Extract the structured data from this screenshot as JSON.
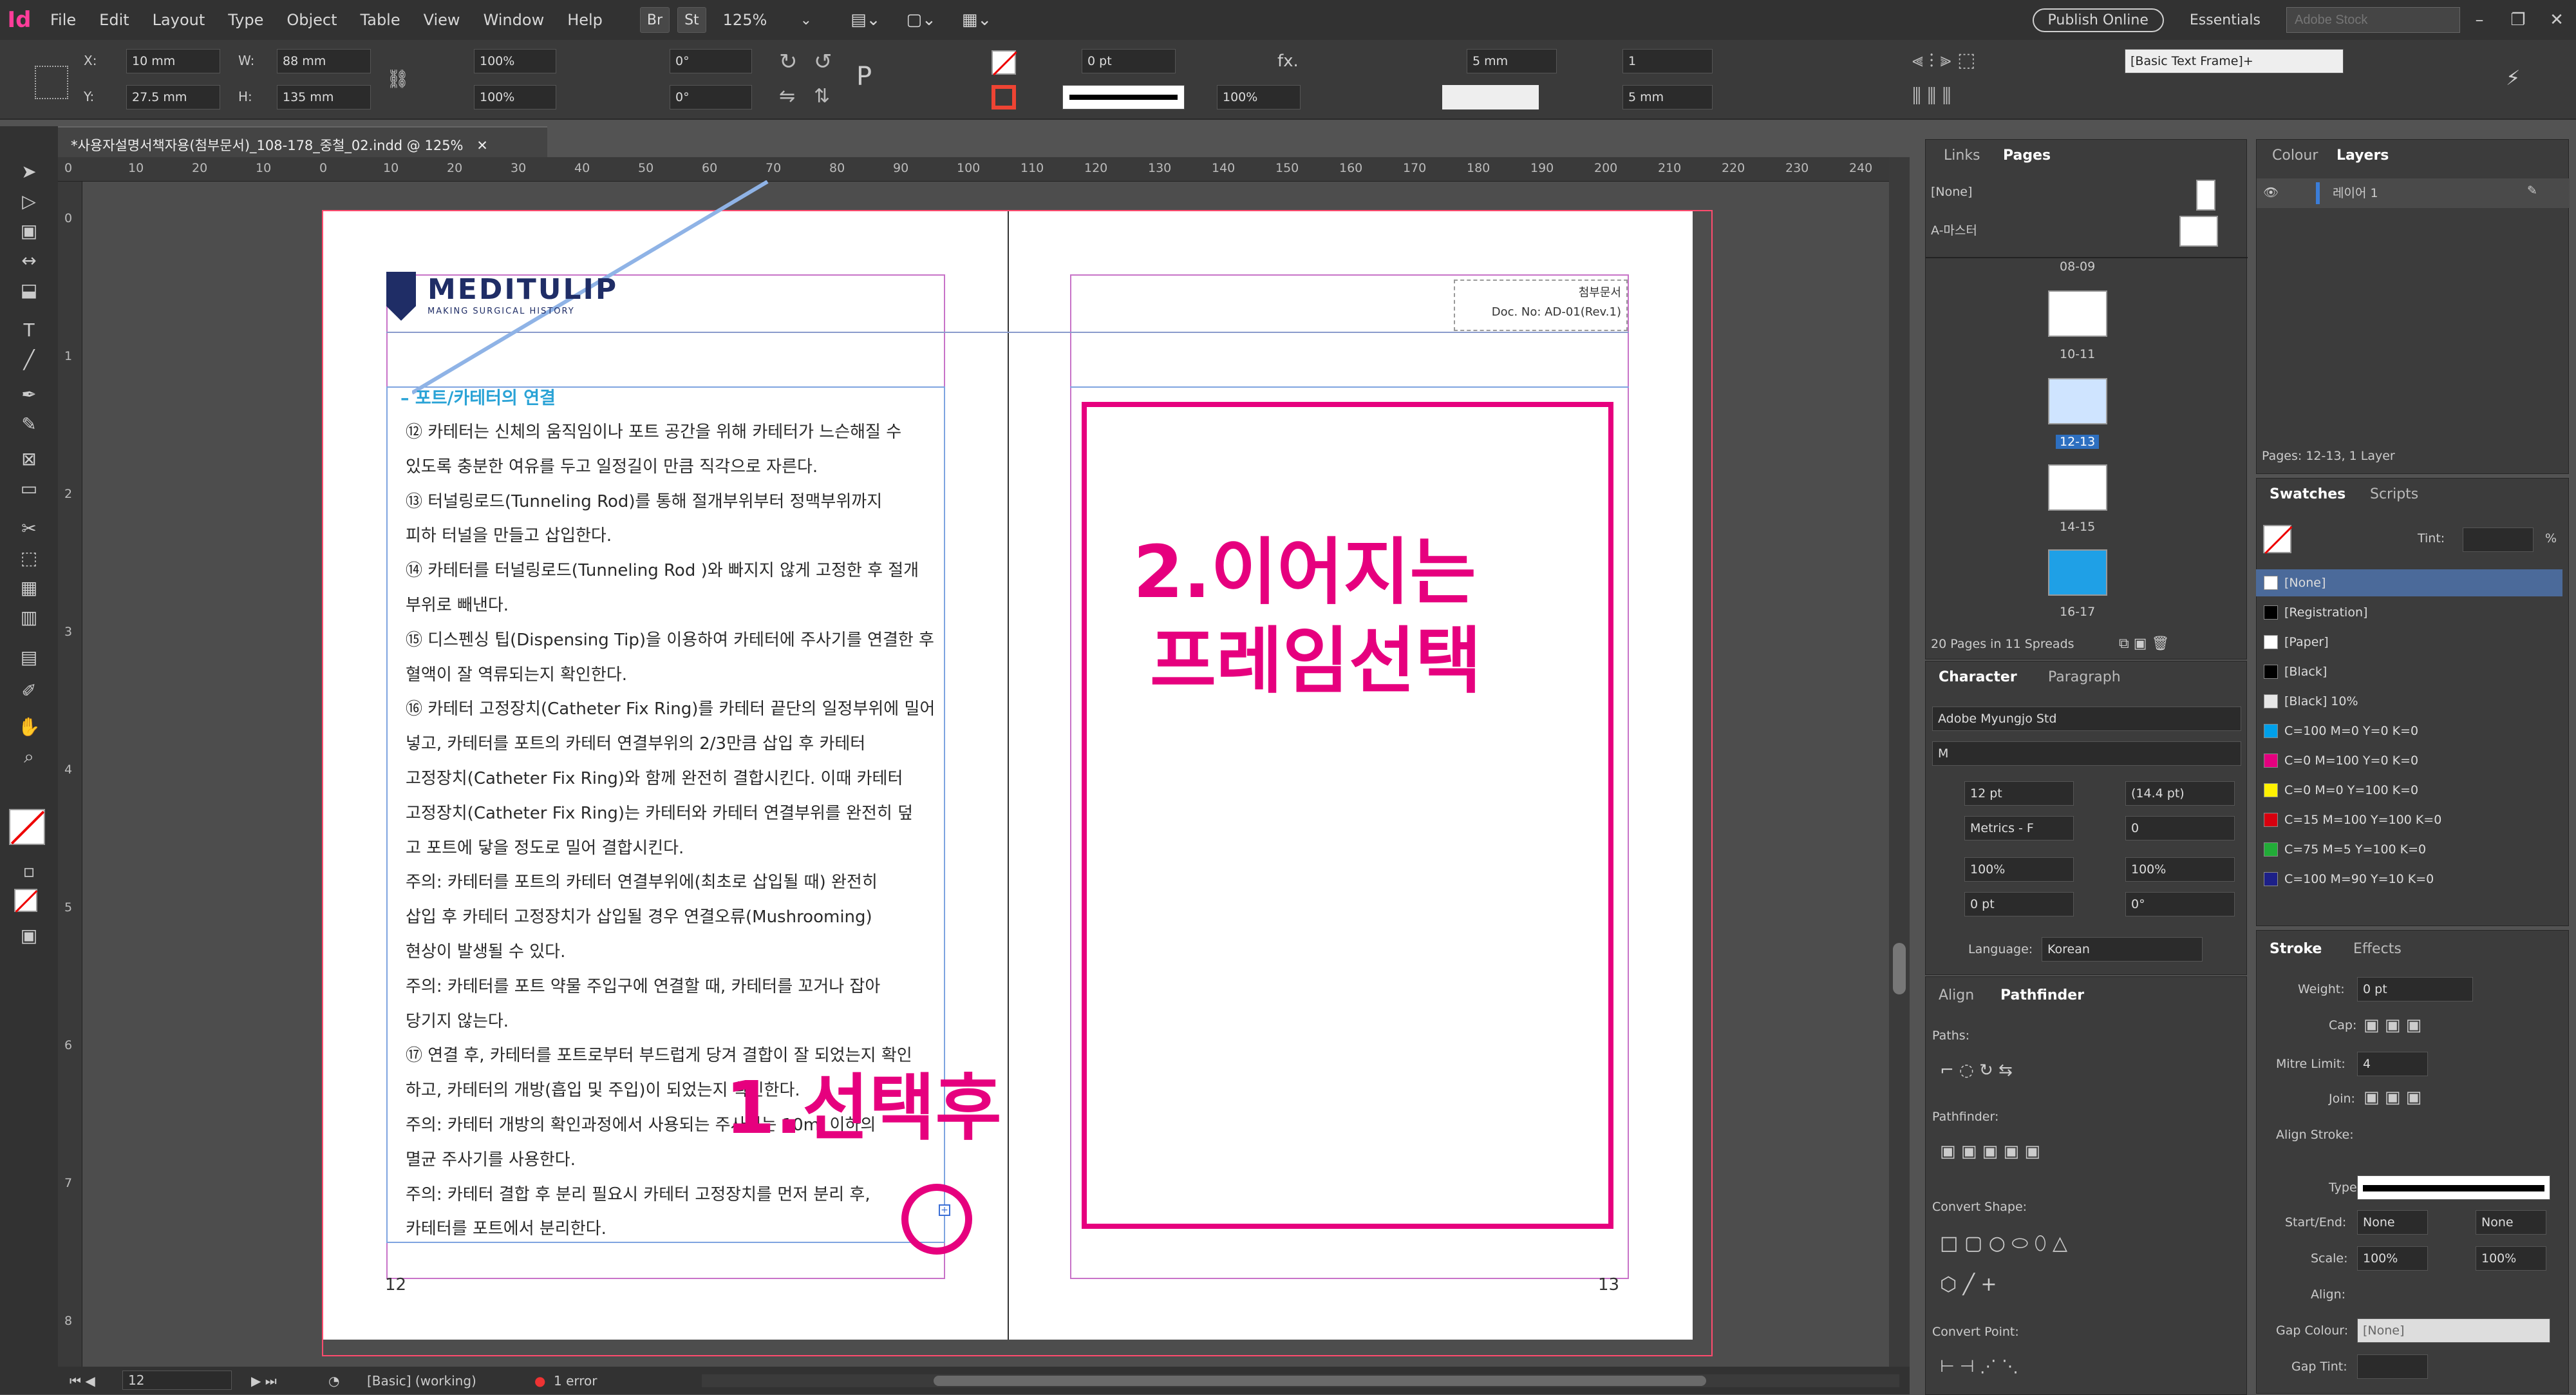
{
  "app": {
    "logo": "Id"
  },
  "menu": [
    "File",
    "Edit",
    "Layout",
    "Type",
    "Object",
    "Table",
    "View",
    "Window",
    "Help"
  ],
  "toolbar": {
    "br": "Br",
    "st": "St",
    "zoom": "125%",
    "publish": "Publish Online",
    "workspace": "Essentials",
    "search_placeholder": "Adobe Stock"
  },
  "control": {
    "x": "10 mm",
    "y": "27.5 mm",
    "w": "88 mm",
    "h": "135 mm",
    "scale_x": "100%",
    "scale_y": "100%",
    "rotate": "0°",
    "shear": "0°",
    "stroke_weight": "0 pt",
    "opacity": "100%",
    "gap": "5 mm",
    "cols": "1",
    "col_gap": "5 mm",
    "frame_style": "[Basic Text Frame]+",
    "text_offset": "5 mm"
  },
  "document": {
    "tab_title": "*사용자설명서책자용(첨부문서)_108-178_중철_02.indd @ 125%"
  },
  "ruler": {
    "h": [
      "0",
      "10",
      "20",
      "10",
      "0",
      "10",
      "20",
      "30",
      "40",
      "50",
      "60",
      "70",
      "80",
      "90",
      "100",
      "110",
      "120",
      "130",
      "140",
      "150",
      "160",
      "170",
      "180",
      "190",
      "200",
      "210",
      "220",
      "230",
      "240"
    ],
    "v": [
      "0",
      "1",
      "2",
      "3",
      "4",
      "5",
      "6",
      "7",
      "8"
    ]
  },
  "page_left": {
    "logo": "MEDITULIP",
    "logo_sub": "MAKING SURGICAL HISTORY",
    "section": "– 포트/카테터의 연결",
    "lines": [
      "⑫ 카테터는 신체의 움직임이나 포트 공간을 위해 카테터가 느슨해질 수",
      "    있도록 충분한 여유를 두고 일정길이 만큼 직각으로 자른다.",
      "⑬ 터널링로드(Tunneling Rod)를 통해 절개부위부터 정맥부위까지",
      "    피하 터널을 만들고 삽입한다.",
      "⑭ 카테터를 터널링로드(Tunneling Rod )와 빠지지 않게 고정한 후 절개",
      "    부위로 빼낸다.",
      "⑮ 디스펜싱 팁(Dispensing Tip)을 이용하여 카테터에 주사기를 연결한 후",
      "    혈액이 잘 역류되는지 확인한다.",
      "⑯ 카테터 고정장치(Catheter Fix Ring)를 카테터 끝단의 일정부위에 밀어",
      "    넣고, 카테터를 포트의 카테터 연결부위의 2/3만큼 삽입 후 카테터",
      "    고정장치(Catheter Fix Ring)와 함께 완전히 결합시킨다. 이때 카테터",
      "    고정장치(Catheter Fix Ring)는 카테터와 카테터 연결부위를 완전히 덮",
      "    고 포트에 닿을 정도로 밀어 결합시킨다.",
      "   주의: 카테터를 포트의 카테터 연결부위에(최초로 삽입될 때) 완전히",
      "          삽입 후 카테터 고정장치가 삽입될 경우 연결오류(Mushrooming)",
      "          현상이 발생될 수 있다.",
      "   주의: 카테터를 포트 약물 주입구에 연결할 때, 카테터를 꼬거나 잡아",
      "          당기지 않는다.",
      "⑰ 연결 후, 카테터를 포트로부터 부드럽게 당겨 결합이 잘 되었는지 확인",
      "    하고, 카테터의 개방(흡입 및 주입)이 되었는지 확인한다.",
      "   주의: 카테터 개방의 확인과정에서 사용되는 주사기는 10ml 이하의",
      "          멸균 주사기를 사용한다.",
      "   주의: 카테터 결합 후 분리 필요시 카테터 고정장치를 먼저 분리 후,",
      "          카테터를 포트에서 분리한다."
    ],
    "page_number": "12"
  },
  "page_right": {
    "doc_line1": "첨부문서",
    "doc_line2": "Doc. No: AD-01(Rev.1)",
    "page_number": "13"
  },
  "annotations": {
    "step1": "1.선택후",
    "step2_line1": "2.이어지는",
    "step2_line2": "프레임선택"
  },
  "status": {
    "page": "12",
    "style": "[Basic] (working)",
    "errors": "1 error"
  },
  "panels": {
    "links_tab": "Links",
    "pages_tab": "Pages",
    "colour_tab": "Colour",
    "layers_tab": "Layers",
    "none_master": "[None]",
    "a_master": "A-마스터",
    "spreads": [
      "08-09",
      "10-11",
      "12-13",
      "14-15",
      "16-17"
    ],
    "pages_info": "20 Pages in 11 Spreads",
    "layer_name": "레이어 1",
    "layers_info": "Pages: 12-13, 1 Layer",
    "swatches_tab": "Swatches",
    "scripts_tab": "Scripts",
    "tint_label": "Tint:",
    "tint_unit": "%",
    "swatches": [
      {
        "name": "[None]",
        "color": "#ffffff"
      },
      {
        "name": "[Registration]",
        "color": "#000000"
      },
      {
        "name": "[Paper]",
        "color": "#ffffff"
      },
      {
        "name": "[Black]",
        "color": "#000000"
      },
      {
        "name": "[Black] 10%",
        "color": "#e6e6e6"
      },
      {
        "name": "C=100 M=0 Y=0 K=0",
        "color": "#00a0e9"
      },
      {
        "name": "C=0 M=100 Y=0 K=0",
        "color": "#e4007f"
      },
      {
        "name": "C=0 M=0 Y=100 K=0",
        "color": "#fff100"
      },
      {
        "name": "C=15 M=100 Y=100 K=0",
        "color": "#d7000f"
      },
      {
        "name": "C=75 M=5 Y=100 K=0",
        "color": "#22ac38"
      },
      {
        "name": "C=100 M=90 Y=10 K=0",
        "color": "#1d2088"
      }
    ],
    "character_tab": "Character",
    "paragraph_tab": "Paragraph",
    "font": "Adobe Myungjo Std",
    "font_style": "M",
    "font_size": "12 pt",
    "leading": "(14.4 pt)",
    "kerning": "Metrics - F",
    "tracking": "0",
    "v_scale": "100%",
    "h_scale": "100%",
    "baseline": "0 pt",
    "skew": "0°",
    "language_label": "Language:",
    "language": "Korean",
    "align_tab": "Align",
    "pathfinder_tab": "Pathfinder",
    "paths_label": "Paths:",
    "pathfinder_label": "Pathfinder:",
    "convert_shape_label": "Convert Shape:",
    "convert_point_label": "Convert Point:",
    "stroke_tab": "Stroke",
    "effects_tab": "Effects",
    "stroke": {
      "weight_label": "Weight:",
      "weight": "0 pt",
      "cap_label": "Cap:",
      "mitre_label": "Mitre Limit:",
      "mitre": "4",
      "join_label": "Join:",
      "align_label": "Align Stroke:",
      "type_label": "Type:",
      "start_label": "Start/End:",
      "start": "None",
      "end": "None",
      "scale_label": "Scale:",
      "scale1": "100%",
      "scale2": "100%",
      "align2_label": "Align:",
      "gap_colour_label": "Gap Colour:",
      "gap_colour": "[None]",
      "gap_tint_label": "Gap Tint:"
    }
  }
}
